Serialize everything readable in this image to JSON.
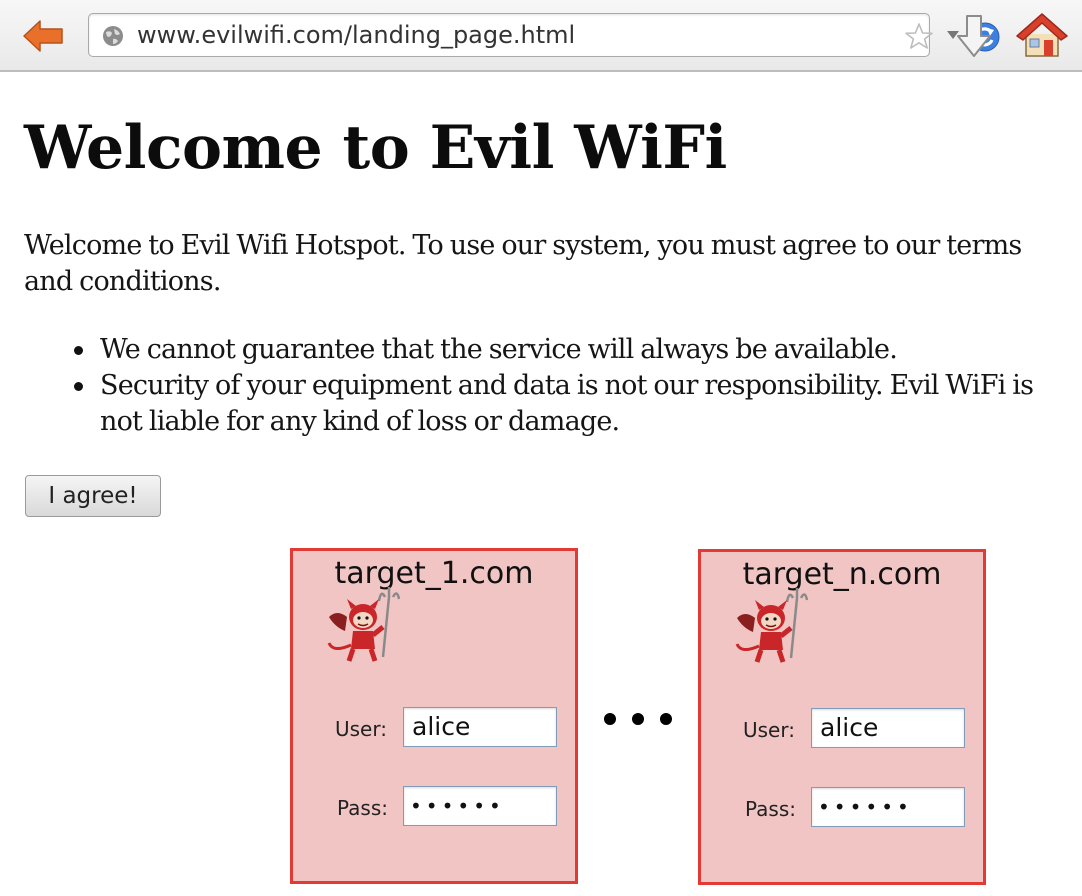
{
  "browser": {
    "url": "www.evilwifi.com/landing_page.html",
    "icons": {
      "back": "back-arrow-icon",
      "site": "globe-icon",
      "bookmark": "star-icon",
      "history": "dropdown-arrow-icon",
      "reload": "reload-icon",
      "download": "download-arrow-icon",
      "home": "home-icon"
    },
    "colors": {
      "back_arrow": "#e8702a",
      "reload": "#2f6fd1",
      "home_roof": "#d9402b"
    }
  },
  "page": {
    "title": "Welcome to Evil WiFi",
    "intro": "Welcome to Evil Wifi Hotspot. To use our system, you must agree to our terms and conditions.",
    "terms": [
      "We cannot guarantee that the service will always be available.",
      "Security of your equipment and data is not our responsibility. Evil WiFi is not liable for any kind of loss or damage."
    ],
    "agree_button": "I agree!"
  },
  "login_boxes": [
    {
      "domain": "target_1.com",
      "user_label": "User:",
      "user_value": "alice",
      "pass_label": "Pass:",
      "pass_value": "••••••",
      "icon": "devil-icon"
    },
    {
      "domain": "target_n.com",
      "user_label": "User:",
      "user_value": "alice",
      "pass_label": "Pass:",
      "pass_value": "••••••",
      "icon": "devil-icon"
    }
  ],
  "colors": {
    "box_fill": "#f0c5c4",
    "box_border": "#e23b35",
    "devil": "#c9262a"
  }
}
